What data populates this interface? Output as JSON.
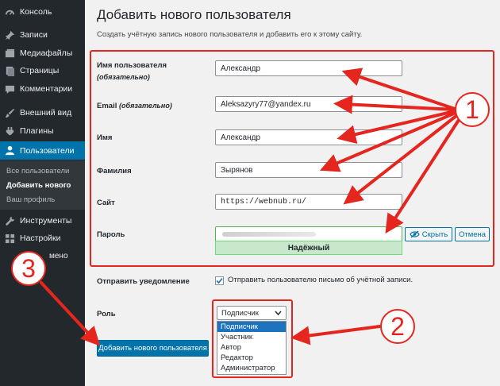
{
  "sidebar": {
    "items": [
      {
        "label": "Консоль",
        "icon": "dashboard-icon"
      },
      {
        "label": "Записи",
        "icon": "pin-icon"
      },
      {
        "label": "Медиафайлы",
        "icon": "media-icon"
      },
      {
        "label": "Страницы",
        "icon": "pages-icon"
      },
      {
        "label": "Комментарии",
        "icon": "comment-icon"
      },
      {
        "label": "Внешний вид",
        "icon": "paintbrush-icon"
      },
      {
        "label": "Плагины",
        "icon": "plugin-icon"
      },
      {
        "label": "Пользователи",
        "icon": "users-icon"
      },
      {
        "label": "Инструменты",
        "icon": "wrench-icon"
      },
      {
        "label": "Настройки",
        "icon": "settings-icon"
      }
    ],
    "submenu": [
      "Все пользователи",
      "Добавить нового",
      "Ваш профиль"
    ],
    "collapse_partial": "мено"
  },
  "page": {
    "title": "Добавить нового пользователя",
    "subtitle": "Создать учётную запись нового пользователя и добавить его к этому сайту."
  },
  "form": {
    "username_label": "Имя пользователя",
    "username_req": "(обязательно)",
    "username_value": "Александр",
    "email_label": "Email",
    "email_req": "(обязательно)",
    "email_value": "Aleksazyry77@yandex.ru",
    "first_name_label": "Имя",
    "first_name_value": "Александр",
    "last_name_label": "Фамилия",
    "last_name_value": "Зырянов",
    "site_label": "Сайт",
    "site_value": "https://webnub.ru/",
    "password_label": "Пароль",
    "password_strength": "Надёжный",
    "hide_button": "Скрыть",
    "cancel_button": "Отмена",
    "notify_label": "Отправить уведомление",
    "notify_text": "Отправить пользователю письмо об учётной записи.",
    "notify_checked": true,
    "role_label": "Роль",
    "role_selected": "Подписчик",
    "role_options": [
      "Подписчик",
      "Участник",
      "Автор",
      "Редактор",
      "Администратор"
    ],
    "submit_button": "Добавить нового пользователя"
  },
  "annotations": {
    "badges": [
      "1",
      "2",
      "3"
    ],
    "color": "#e5261f"
  },
  "colors": {
    "sidebar_bg": "#23282d",
    "accent": "#0073aa",
    "strength_ok": "#c7e8ca"
  }
}
